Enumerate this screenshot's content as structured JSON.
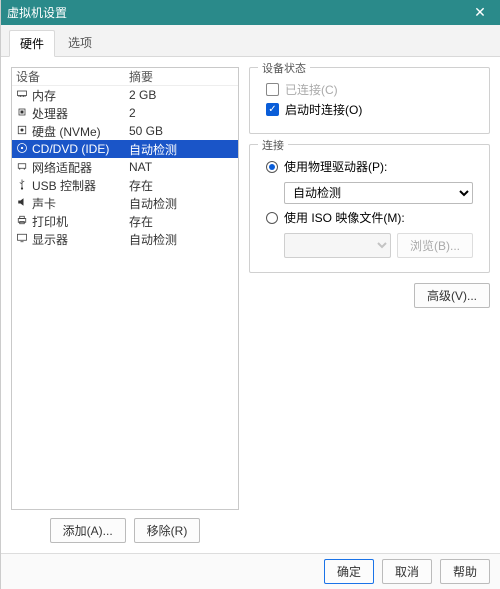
{
  "window": {
    "title": "虚拟机设置",
    "close": "✕"
  },
  "tabs": {
    "items": [
      "硬件",
      "选项"
    ],
    "active": 0
  },
  "device_table": {
    "headers": {
      "device": "设备",
      "summary": "摘要"
    },
    "rows": [
      {
        "icon": "memory-icon",
        "name": "内存",
        "summary": "2 GB",
        "selected": false
      },
      {
        "icon": "cpu-icon",
        "name": "处理器",
        "summary": "2",
        "selected": false
      },
      {
        "icon": "disk-icon",
        "name": "硬盘 (NVMe)",
        "summary": "50 GB",
        "selected": false
      },
      {
        "icon": "cd-icon",
        "name": "CD/DVD (IDE)",
        "summary": "自动检测",
        "selected": true
      },
      {
        "icon": "net-icon",
        "name": "网络适配器",
        "summary": "NAT",
        "selected": false
      },
      {
        "icon": "usb-icon",
        "name": "USB 控制器",
        "summary": "存在",
        "selected": false
      },
      {
        "icon": "sound-icon",
        "name": "声卡",
        "summary": "自动检测",
        "selected": false
      },
      {
        "icon": "printer-icon",
        "name": "打印机",
        "summary": "存在",
        "selected": false
      },
      {
        "icon": "display-icon",
        "name": "显示器",
        "summary": "自动检测",
        "selected": false
      }
    ]
  },
  "left_buttons": {
    "add": "添加(A)...",
    "remove": "移除(R)"
  },
  "status_group": {
    "legend": "设备状态",
    "connected": {
      "label": "已连接(C)",
      "checked": false,
      "disabled": true
    },
    "connect_on_power": {
      "label": "启动时连接(O)",
      "checked": true
    }
  },
  "connection_group": {
    "legend": "连接",
    "use_physical": {
      "label": "使用物理驱动器(P):",
      "checked": true
    },
    "physical_options": [
      "自动检测"
    ],
    "physical_selected": "自动检测",
    "use_iso": {
      "label": "使用 ISO 映像文件(M):",
      "checked": false
    },
    "iso_path": "",
    "browse": "浏览(B)..."
  },
  "advanced": {
    "label": "高级(V)..."
  },
  "footer": {
    "ok": "确定",
    "cancel": "取消",
    "help": "帮助"
  }
}
